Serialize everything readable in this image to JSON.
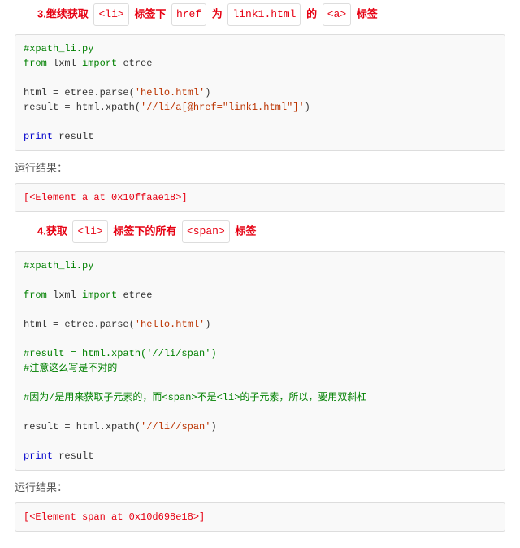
{
  "heading3": {
    "prefix": "3.继续获取",
    "pill1": "<li>",
    "t1": "标签下",
    "pill2": "href",
    "t2": "为",
    "pill3": "link1.html",
    "t3": "的",
    "pill4": "<a>",
    "t4": "标签"
  },
  "code3": {
    "l1": "#xpath_li.py",
    "l2a": "from",
    "l2b": " lxml ",
    "l2c": "import",
    "l2d": " etree",
    "l3": "",
    "l4a": "html = etree.parse(",
    "l4b": "'hello.html'",
    "l4c": ")",
    "l5a": "result = html.xpath(",
    "l5b": "'//li/a[@href=\"link1.html\"]'",
    "l5c": ")",
    "l6": "",
    "l7a": "print",
    "l7b": " result"
  },
  "run_label": "运行结果：",
  "result3": "[<Element a at 0x10ffaae18>]",
  "heading4": {
    "prefix": "4.获取",
    "pill1": "<li>",
    "t1": "标签下的所有",
    "pill2": "<span>",
    "t2": "标签"
  },
  "code4": {
    "l1": "#xpath_li.py",
    "l2": "",
    "l3a": "from",
    "l3b": " lxml ",
    "l3c": "import",
    "l3d": " etree",
    "l4": "",
    "l5a": "html = etree.parse(",
    "l5b": "'hello.html'",
    "l5c": ")",
    "l6": "",
    "l7": "#result = html.xpath('//li/span')",
    "l8": "#注意这么写是不对的",
    "l9": "",
    "l10": "#因为/是用来获取子元素的，而<span>不是<li>的子元素，所以，要用双斜杠",
    "l11": "",
    "l12a": "result = html.xpath(",
    "l12b": "'//li//span'",
    "l12c": ")",
    "l13": "",
    "l14a": "print",
    "l14b": " result"
  },
  "result4": "[<Element span at 0x10d698e18>]"
}
